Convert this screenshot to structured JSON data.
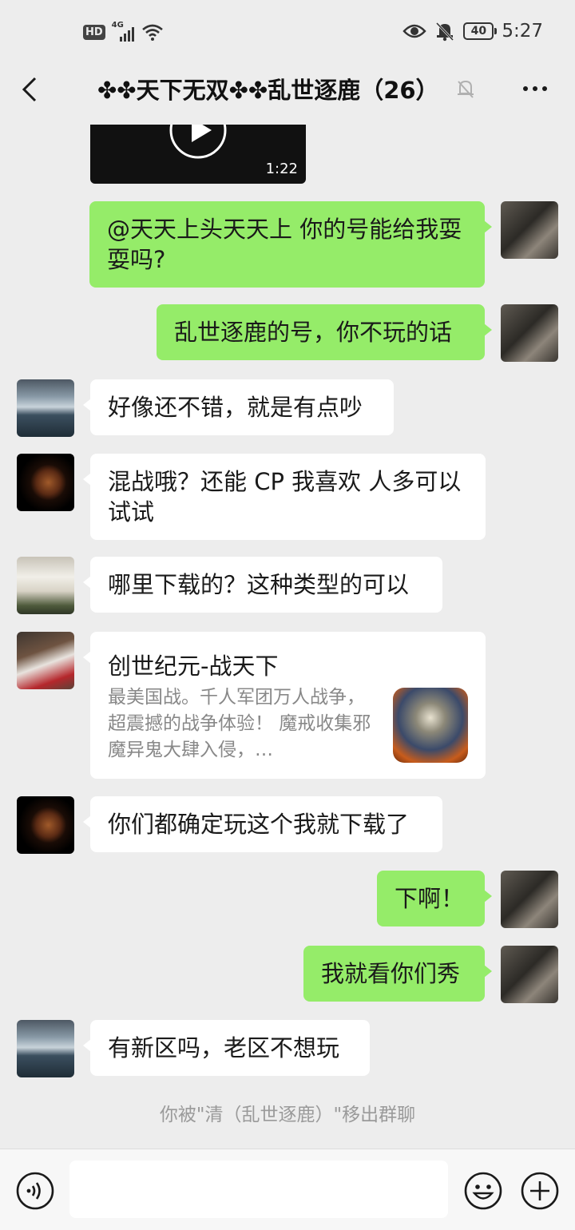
{
  "status_bar": {
    "hd": "HD",
    "network": "4G",
    "battery": "40",
    "time": "5:27",
    "icons": [
      "signal-icon",
      "wifi-icon",
      "eye-icon",
      "bell-off-icon",
      "battery-icon"
    ]
  },
  "header": {
    "title": "✤✤天下无双✤✤乱世逐鹿",
    "member_count": "（26）",
    "icons": [
      "back-arrow-icon",
      "mute-bell-icon",
      "more-dots-icon"
    ]
  },
  "video": {
    "duration": "1:22",
    "icon": "play-icon"
  },
  "messages": [
    {
      "side": "right",
      "text": "@天天上头天天上  你的号能给我耍耍吗?"
    },
    {
      "side": "right",
      "text": "乱世逐鹿的号，你不玩的话"
    },
    {
      "side": "left",
      "text": "好像还不错，就是有点吵"
    },
    {
      "side": "left",
      "text": "混战哦？还能 CP 我喜欢   人多可以试试"
    },
    {
      "side": "left",
      "text": "哪里下载的？这种类型的可以"
    },
    {
      "side": "left",
      "text": "你们都确定玩这个我就下载了"
    },
    {
      "side": "right",
      "text": "下啊！"
    },
    {
      "side": "right",
      "text": "我就看你们秀"
    },
    {
      "side": "left",
      "text": "有新区吗，老区不想玩"
    }
  ],
  "app_card": {
    "title": "创世纪元-战天下",
    "description": "最美国战。千人军团万人战争，超震撼的战争体验！ 魔戒收集邪魔异鬼大肆入侵，…"
  },
  "system_message": "你被\"清（乱世逐鹿）\"移出群聊",
  "input_bar": {
    "placeholder": "",
    "icons": [
      "voice-icon",
      "emoji-icon",
      "plus-icon"
    ]
  },
  "colors": {
    "background": "#ededed",
    "self_bubble": "#95ec69",
    "other_bubble": "#ffffff"
  }
}
